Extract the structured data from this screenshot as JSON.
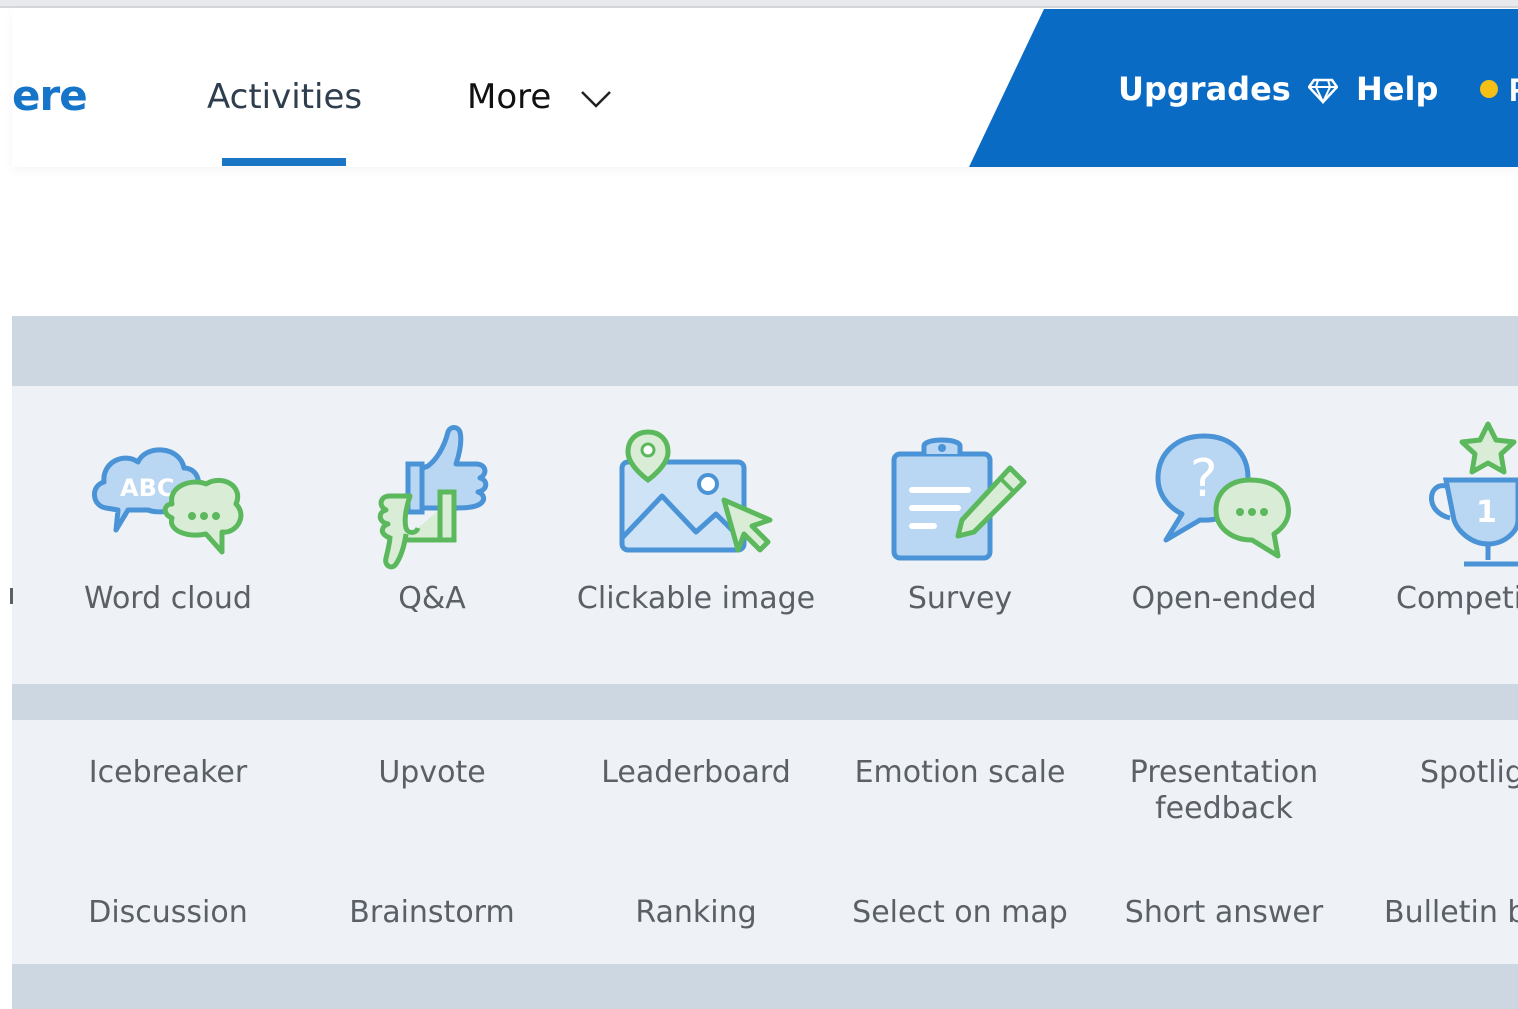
{
  "nav": {
    "logo_fragment": "ere",
    "activities": "Activities",
    "more": "More",
    "upgrades": "Upgrades",
    "help": "Help",
    "right_fragment": "F"
  },
  "tiles": [
    {
      "label": "Word cloud",
      "icon": "word-cloud-icon"
    },
    {
      "label": "Q&A",
      "icon": "thumbs-up-down-icon"
    },
    {
      "label": "Clickable image",
      "icon": "clickable-image-icon"
    },
    {
      "label": "Survey",
      "icon": "survey-clipboard-icon"
    },
    {
      "label": "Open-ended",
      "icon": "open-ended-question-icon"
    },
    {
      "label": "Competi",
      "icon": "trophy-icon"
    }
  ],
  "row2": [
    "Icebreaker",
    "Upvote",
    "Leaderboard",
    "Emotion scale",
    "Presentation feedback",
    "Spotlig"
  ],
  "row3": [
    "Discussion",
    "Brainstorm",
    "Ranking",
    "Select on map",
    "Short answer",
    "Bulletin b"
  ],
  "colors": {
    "brand_blue": "#0a6bc5",
    "accent_green": "#5cb85c",
    "icon_blue": "#4a93d6",
    "dot_yellow": "#f4c015"
  }
}
